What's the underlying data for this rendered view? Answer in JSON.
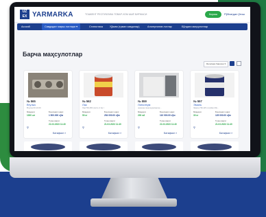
{
  "header": {
    "logo_text": "UZ\nEX",
    "brand": "YARMARKA",
    "tagline": "ТОШКЕНТ РЕСПУБЛИКА ТОВАР-ХОМ АШЁ БИРЖАСИ",
    "login": "Кириш",
    "register": "Рўйхатдан ўтиш"
  },
  "nav": {
    "items": [
      {
        "label": "Асосий",
        "active": false
      },
      {
        "label": "Савдодан чиқиш лотлари ▾",
        "active": true
      },
      {
        "label": "Статистика",
        "active": false
      },
      {
        "label": "Ҳўжим (туман савдолар)",
        "active": false
      },
      {
        "label": "Альтернатив лотлар",
        "active": false
      },
      {
        "label": "Бўлдаги маҳсулотлар",
        "active": false
      }
    ]
  },
  "main": {
    "title": "Барча маҳсулотлар",
    "sort_label": "Янгилари биринчи ▾"
  },
  "products": [
    {
      "id": "№ 565",
      "name": "Втулка",
      "desc": "Втулка 00.10.00",
      "qty_label": "Миқдори:",
      "qty": "1000 шт",
      "price_label": "Бошланғич нарх:",
      "price": "1 500.000 сўм",
      "date_label": "Тугаш вақти:",
      "date": "21.03.2023 11:40",
      "more": "Батафсил »"
    },
    {
      "id": "№ 562",
      "name": "Лак",
      "desc": "Лак ПФ-283 (cатте 2 fe) l",
      "qty_label": "Миқдори:",
      "qty": "50 кг",
      "price_label": "Бошланғич нарх:",
      "price": "254 000.00 сўм",
      "date_label": "Тугаш вақти:",
      "date": "21.03.2023 11:40",
      "more": "Батафсил »"
    },
    {
      "id": "№ 559",
      "name": "Линолеум",
      "desc": "ширина линолеумланган...",
      "qty_label": "Миқдори:",
      "qty": "200 м2",
      "price_label": "Бошланғич нарх:",
      "price": "110 000.00 сўм",
      "date_label": "Тугаш вақти:",
      "date": "21.03.2023 11:40",
      "more": "Батафсил »"
    },
    {
      "id": "№ 557",
      "name": "Эмаль",
      "desc": "Эмаль ПФ-115 голубая 20к...",
      "qty_label": "Миқдори:",
      "qty": "30 кг",
      "price_label": "Бошланғич нарх:",
      "price": "125 000.00 сўм",
      "date_label": "Тугаш вақти:",
      "date": "21.03.2023 11:40",
      "more": "Батафсил »"
    }
  ],
  "colors": {
    "brand_blue": "#1c3f8e",
    "accent_green": "#2aa84a"
  }
}
